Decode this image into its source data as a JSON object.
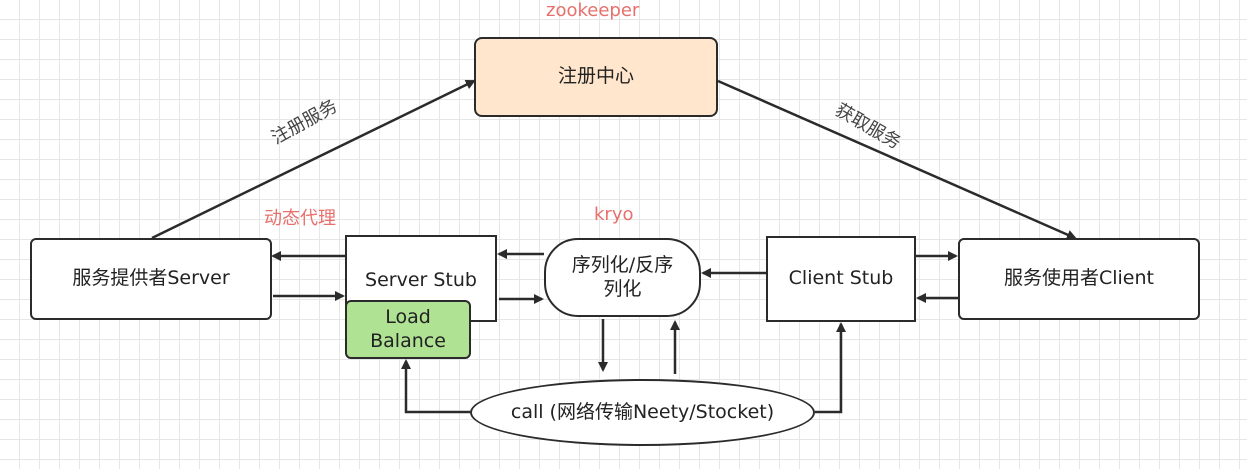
{
  "nodes": {
    "registry": "注册中心",
    "server": "服务提供者Server",
    "server_stub": "Server Stub",
    "load_balance_line1": "Load",
    "load_balance_line2": "Balance",
    "serialize_line1": "序列化/反序",
    "serialize_line2": "列化",
    "client_stub": "Client Stub",
    "client": "服务使用者Client",
    "call": "call (网络传输Neety/Stocket)"
  },
  "labels": {
    "zookeeper": "zookeeper",
    "kryo": "kryo",
    "dynamic_proxy": "动态代理",
    "register_service": "注册服务",
    "fetch_service": "获取服务"
  },
  "colors": {
    "registry_fill": "#ffe6cc",
    "load_balance_fill": "#b0e294",
    "annotation_text": "#e8706c",
    "stroke": "#2b2b2b"
  }
}
